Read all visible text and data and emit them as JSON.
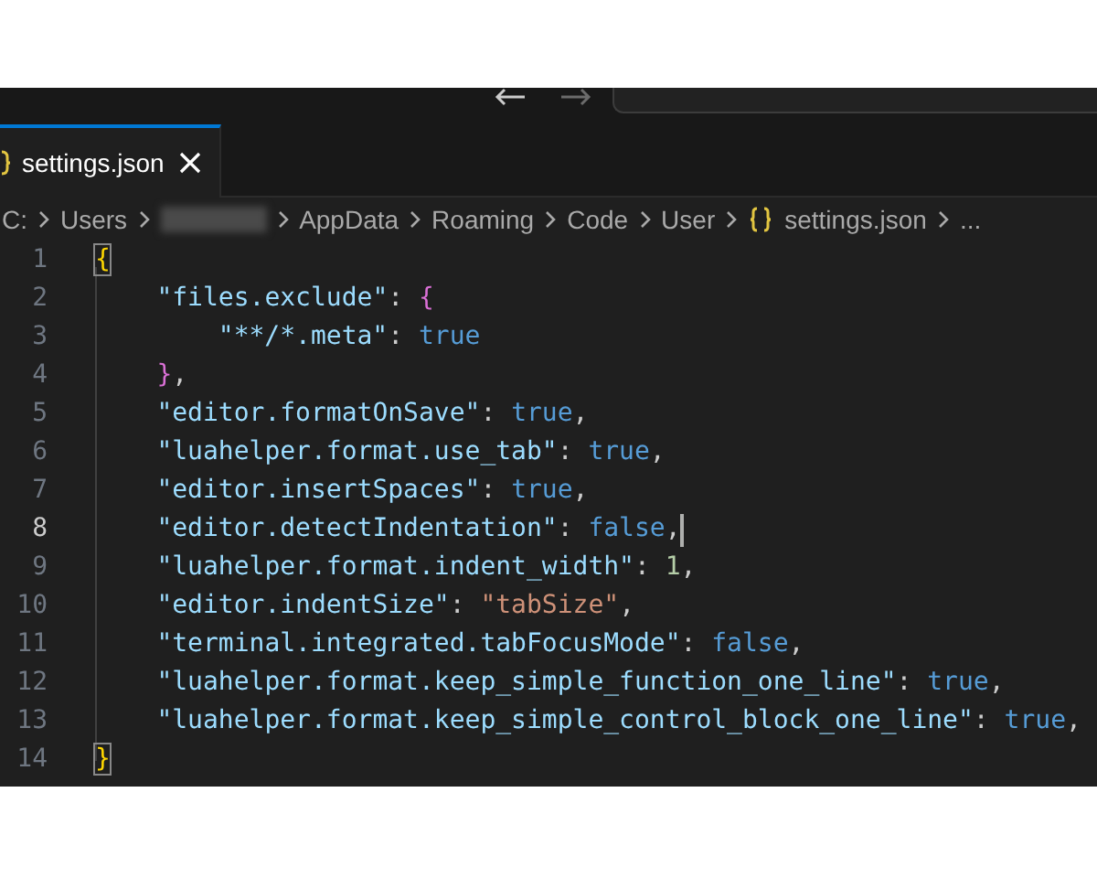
{
  "tab": {
    "label": "settings.json",
    "selected": true
  },
  "breadcrumb": [
    {
      "kind": "folder",
      "label": "C:"
    },
    {
      "kind": "folder",
      "label": "Users"
    },
    {
      "kind": "redacted"
    },
    {
      "kind": "folder",
      "label": "AppData"
    },
    {
      "kind": "folder",
      "label": "Roaming"
    },
    {
      "kind": "folder",
      "label": "Code"
    },
    {
      "kind": "folder",
      "label": "User"
    },
    {
      "kind": "file",
      "label": "settings.json"
    },
    {
      "kind": "ellipsis",
      "label": "..."
    }
  ],
  "lines": [
    {
      "number": "1",
      "current": false,
      "tokens": [
        {
          "kind": "brace1",
          "text": "{"
        }
      ],
      "children": [
        {
          "number": "2",
          "current": false,
          "tokens": [
            {
              "kind": "key",
              "text": "\"files.exclude\""
            },
            {
              "kind": "punct",
              "text": ": "
            },
            {
              "kind": "brace2",
              "text": "{"
            }
          ],
          "children": [
            {
              "number": "3",
              "current": false,
              "tokens": [
                {
                  "kind": "key",
                  "text": "\"**/*.meta\""
                },
                {
                  "kind": "punct",
                  "text": ": "
                },
                {
                  "kind": "bool",
                  "text": "true"
                }
              ]
            }
          ]
        },
        {
          "number": "4",
          "current": false,
          "tokens": [
            {
              "kind": "brace2",
              "text": "}"
            },
            {
              "kind": "punct",
              "text": ","
            }
          ]
        },
        {
          "number": "5",
          "current": false,
          "tokens": [
            {
              "kind": "key",
              "text": "\"editor.formatOnSave\""
            },
            {
              "kind": "punct",
              "text": ": "
            },
            {
              "kind": "bool",
              "text": "true"
            },
            {
              "kind": "punct",
              "text": ","
            }
          ]
        },
        {
          "number": "6",
          "current": false,
          "tokens": [
            {
              "kind": "key",
              "text": "\"luahelper.format.use_tab\""
            },
            {
              "kind": "punct",
              "text": ": "
            },
            {
              "kind": "bool",
              "text": "true"
            },
            {
              "kind": "punct",
              "text": ","
            }
          ]
        },
        {
          "number": "7",
          "current": false,
          "tokens": [
            {
              "kind": "key",
              "text": "\"editor.insertSpaces\""
            },
            {
              "kind": "punct",
              "text": ": "
            },
            {
              "kind": "bool",
              "text": "true"
            },
            {
              "kind": "punct",
              "text": ","
            }
          ]
        },
        {
          "number": "8",
          "current": true,
          "tokens": [
            {
              "kind": "key",
              "text": "\"editor.detectIndentation\""
            },
            {
              "kind": "punct",
              "text": ": "
            },
            {
              "kind": "bool",
              "text": "false"
            },
            {
              "kind": "punct",
              "text": ","
            }
          ]
        },
        {
          "number": "9",
          "current": false,
          "tokens": [
            {
              "kind": "key",
              "text": "\"luahelper.format.indent_width\""
            },
            {
              "kind": "punct",
              "text": ": "
            },
            {
              "kind": "number",
              "text": "1"
            },
            {
              "kind": "punct",
              "text": ","
            }
          ]
        },
        {
          "number": "10",
          "current": false,
          "tokens": [
            {
              "kind": "key",
              "text": "\"editor.indentSize\""
            },
            {
              "kind": "punct",
              "text": ": "
            },
            {
              "kind": "string",
              "text": "\"tabSize\""
            },
            {
              "kind": "punct",
              "text": ","
            }
          ]
        },
        {
          "number": "11",
          "current": false,
          "tokens": [
            {
              "kind": "key",
              "text": "\"terminal.integrated.tabFocusMode\""
            },
            {
              "kind": "punct",
              "text": ": "
            },
            {
              "kind": "bool",
              "text": "false"
            },
            {
              "kind": "punct",
              "text": ","
            }
          ]
        },
        {
          "number": "12",
          "current": false,
          "tokens": [
            {
              "kind": "key",
              "text": "\"luahelper.format.keep_simple_function_one_line\""
            },
            {
              "kind": "punct",
              "text": ": "
            },
            {
              "kind": "bool",
              "text": "true"
            },
            {
              "kind": "punct",
              "text": ","
            }
          ]
        },
        {
          "number": "13",
          "current": false,
          "tokens": [
            {
              "kind": "key",
              "text": "\"luahelper.format.keep_simple_control_block_one_line\""
            },
            {
              "kind": "punct",
              "text": ": "
            },
            {
              "kind": "bool",
              "text": "true"
            },
            {
              "kind": "punct",
              "text": ","
            }
          ]
        }
      ]
    },
    {
      "number": "14",
      "current": false,
      "tokens": [
        {
          "kind": "brace1",
          "text": "}"
        }
      ]
    }
  ]
}
